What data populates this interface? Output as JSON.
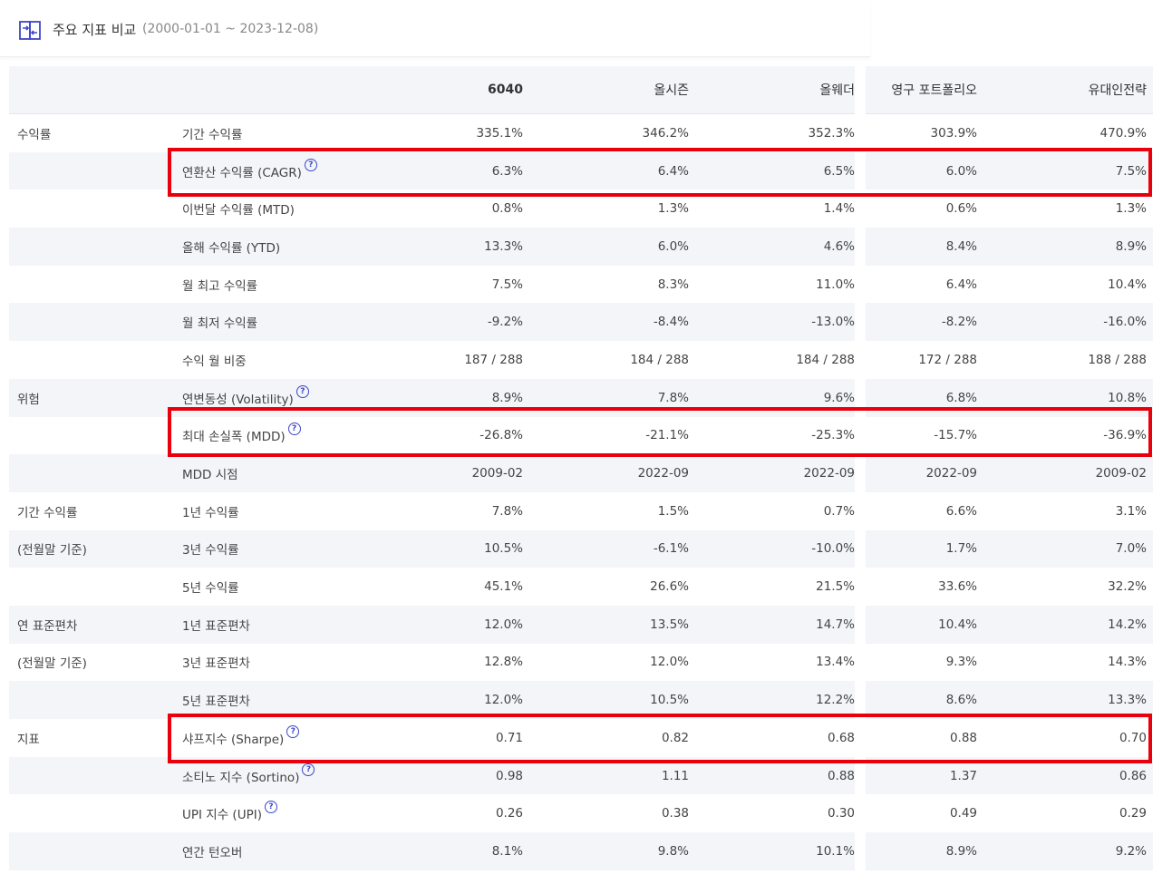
{
  "header": {
    "title": "주요 지표 비교",
    "range": "(2000-01-01 ~ 2023-12-08)"
  },
  "columns": [
    "6040",
    "올시즌",
    "올웨더",
    "영구 포트폴리오",
    "유대인전략"
  ],
  "rows": [
    {
      "category": "수익률",
      "metric": "기간 수익률",
      "help": false,
      "values": [
        "335.1%",
        "346.2%",
        "352.3%",
        "303.9%",
        "470.9%"
      ]
    },
    {
      "category": "",
      "metric": "연환산 수익률 (CAGR)",
      "help": true,
      "values": [
        "6.3%",
        "6.4%",
        "6.5%",
        "6.0%",
        "7.5%"
      ]
    },
    {
      "category": "",
      "metric": "이번달 수익률 (MTD)",
      "help": false,
      "values": [
        "0.8%",
        "1.3%",
        "1.4%",
        "0.6%",
        "1.3%"
      ]
    },
    {
      "category": "",
      "metric": "올해 수익률 (YTD)",
      "help": false,
      "values": [
        "13.3%",
        "6.0%",
        "4.6%",
        "8.4%",
        "8.9%"
      ]
    },
    {
      "category": "",
      "metric": "월 최고 수익률",
      "help": false,
      "values": [
        "7.5%",
        "8.3%",
        "11.0%",
        "6.4%",
        "10.4%"
      ]
    },
    {
      "category": "",
      "metric": "월 최저 수익률",
      "help": false,
      "values": [
        "-9.2%",
        "-8.4%",
        "-13.0%",
        "-8.2%",
        "-16.0%"
      ]
    },
    {
      "category": "",
      "metric": "수익 월 비중",
      "help": false,
      "values": [
        "187 / 288",
        "184 / 288",
        "184 / 288",
        "172 / 288",
        "188 / 288"
      ]
    },
    {
      "category": "위험",
      "metric": "연변동성 (Volatility)",
      "help": true,
      "values": [
        "8.9%",
        "7.8%",
        "9.6%",
        "6.8%",
        "10.8%"
      ]
    },
    {
      "category": "",
      "metric": "최대 손실폭 (MDD)",
      "help": true,
      "values": [
        "-26.8%",
        "-21.1%",
        "-25.3%",
        "-15.7%",
        "-36.9%"
      ]
    },
    {
      "category": "",
      "metric": "MDD 시점",
      "help": false,
      "values": [
        "2009-02",
        "2022-09",
        "2022-09",
        "2022-09",
        "2009-02"
      ]
    },
    {
      "category": "기간 수익률",
      "metric": "1년 수익률",
      "help": false,
      "values": [
        "7.8%",
        "1.5%",
        "0.7%",
        "6.6%",
        "3.1%"
      ]
    },
    {
      "category": "(전월말 기준)",
      "metric": "3년 수익률",
      "help": false,
      "values": [
        "10.5%",
        "-6.1%",
        "-10.0%",
        "1.7%",
        "7.0%"
      ]
    },
    {
      "category": "",
      "metric": "5년 수익률",
      "help": false,
      "values": [
        "45.1%",
        "26.6%",
        "21.5%",
        "33.6%",
        "32.2%"
      ]
    },
    {
      "category": "연 표준편차",
      "metric": "1년 표준편차",
      "help": false,
      "values": [
        "12.0%",
        "13.5%",
        "14.7%",
        "10.4%",
        "14.2%"
      ]
    },
    {
      "category": "(전월말 기준)",
      "metric": "3년 표준편차",
      "help": false,
      "values": [
        "12.8%",
        "12.0%",
        "13.4%",
        "9.3%",
        "14.3%"
      ]
    },
    {
      "category": "",
      "metric": "5년 표준편차",
      "help": false,
      "values": [
        "12.0%",
        "10.5%",
        "12.2%",
        "8.6%",
        "13.3%"
      ]
    },
    {
      "category": "지표",
      "metric": "샤프지수 (Sharpe)",
      "help": true,
      "values": [
        "0.71",
        "0.82",
        "0.68",
        "0.88",
        "0.70"
      ]
    },
    {
      "category": "",
      "metric": "소티노 지수 (Sortino)",
      "help": true,
      "values": [
        "0.98",
        "1.11",
        "0.88",
        "1.37",
        "0.86"
      ]
    },
    {
      "category": "",
      "metric": "UPI 지수 (UPI)",
      "help": true,
      "values": [
        "0.26",
        "0.38",
        "0.30",
        "0.49",
        "0.29"
      ]
    },
    {
      "category": "",
      "metric": "연간 턴오버",
      "help": false,
      "values": [
        "8.1%",
        "9.8%",
        "10.1%",
        "8.9%",
        "9.2%"
      ]
    }
  ],
  "help_glyph": "?",
  "highlight_color": "#e8000c"
}
